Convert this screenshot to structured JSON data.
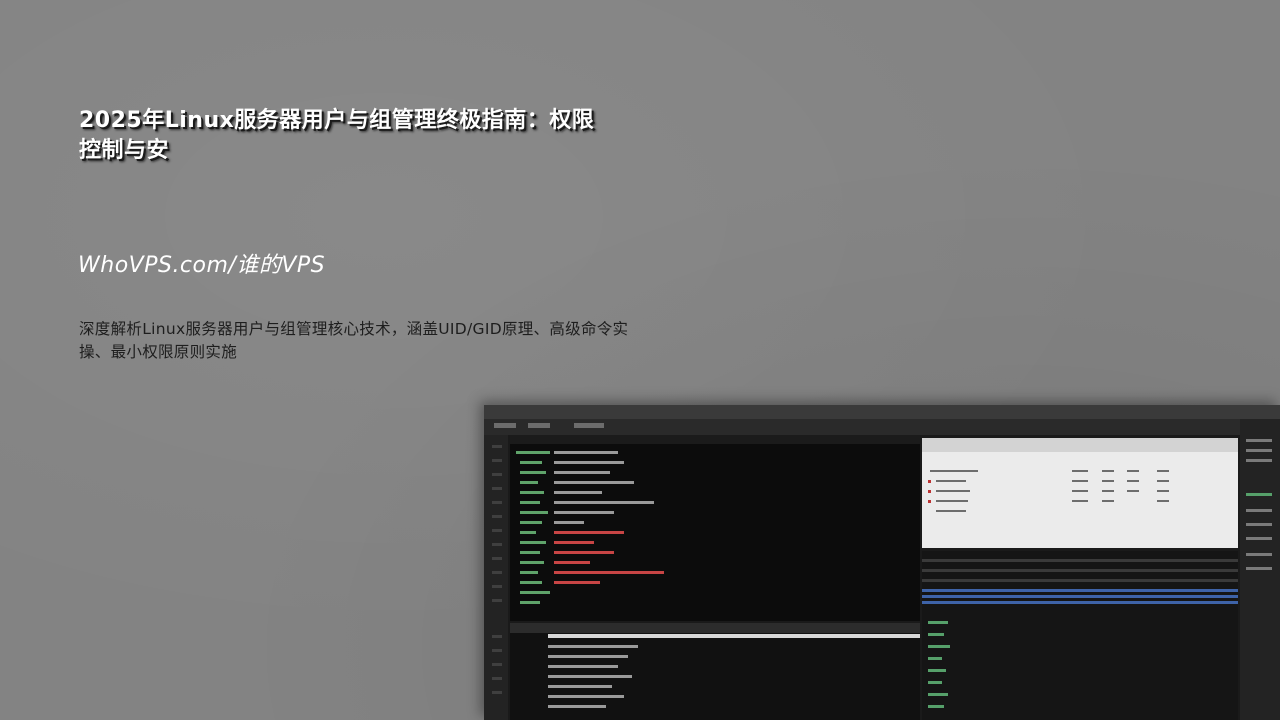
{
  "header": {
    "title": "2025年Linux服务器用户与组管理终极指南：权限控制与安"
  },
  "site": {
    "name": "WhoVPS.com/谁的VPS"
  },
  "description": {
    "text": "深度解析Linux服务器用户与组管理核心技术，涵盖UID/GID原理、高级命令实操、最小权限原则实施"
  },
  "image": {
    "subject": "monitor-screenshot-terminal-windows",
    "colors": {
      "background": "#838383",
      "terminal": "#0c0c0c",
      "accent_green": "#5fa36a",
      "accent_red": "#c84545",
      "accent_blue": "#3e63a8"
    }
  }
}
